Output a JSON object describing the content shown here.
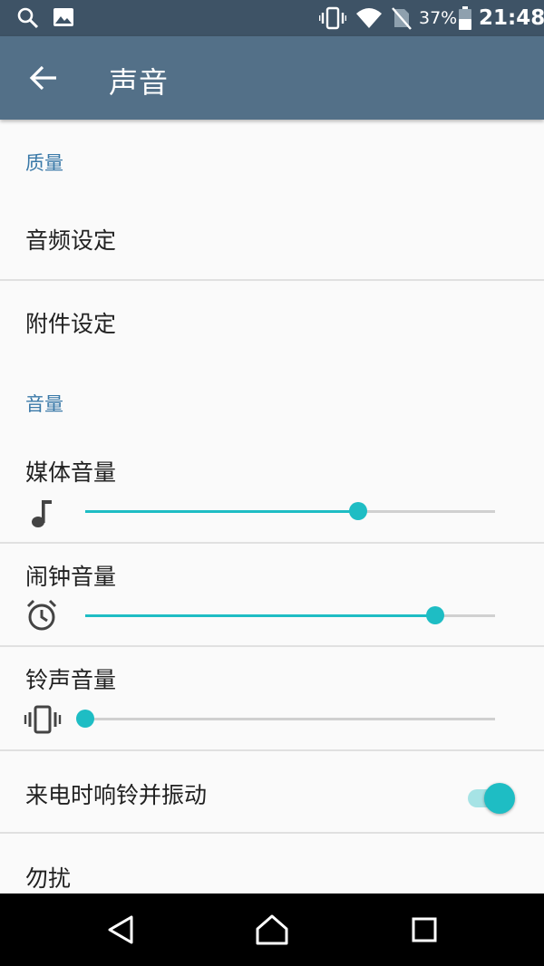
{
  "status_bar": {
    "battery_percent": "37%",
    "time": "21:48",
    "icons": [
      "search-icon",
      "image-icon",
      "vibrate-icon",
      "wifi-icon",
      "no-sim-icon",
      "battery-icon"
    ]
  },
  "app_bar": {
    "title": "声音",
    "back_icon": "arrow-back-icon"
  },
  "sections": {
    "quality": {
      "header": "质量"
    },
    "volume": {
      "header": "音量"
    }
  },
  "settings": {
    "audio_settings": "音频设定",
    "accessory_settings": "附件设定",
    "media_volume": {
      "label": "媒体音量",
      "icon": "music-note-icon",
      "level": 0.665
    },
    "alarm_volume": {
      "label": "闹钟音量",
      "icon": "alarm-icon",
      "level": 0.855
    },
    "ringtone_volume": {
      "label": "铃声音量",
      "icon": "vibrate-icon",
      "level": 0.0
    },
    "vibrate_on_ring": {
      "label": "来电时响铃并振动",
      "enabled": true
    },
    "do_not_disturb": "勿扰"
  },
  "nav_bar": {
    "icons": [
      "back-triangle-icon",
      "home-icon",
      "recents-icon"
    ]
  },
  "colors": {
    "status_bar": "#3e5366",
    "app_bar": "#537088",
    "accent": "#1ebdc4",
    "section_header": "#3a79a8"
  }
}
